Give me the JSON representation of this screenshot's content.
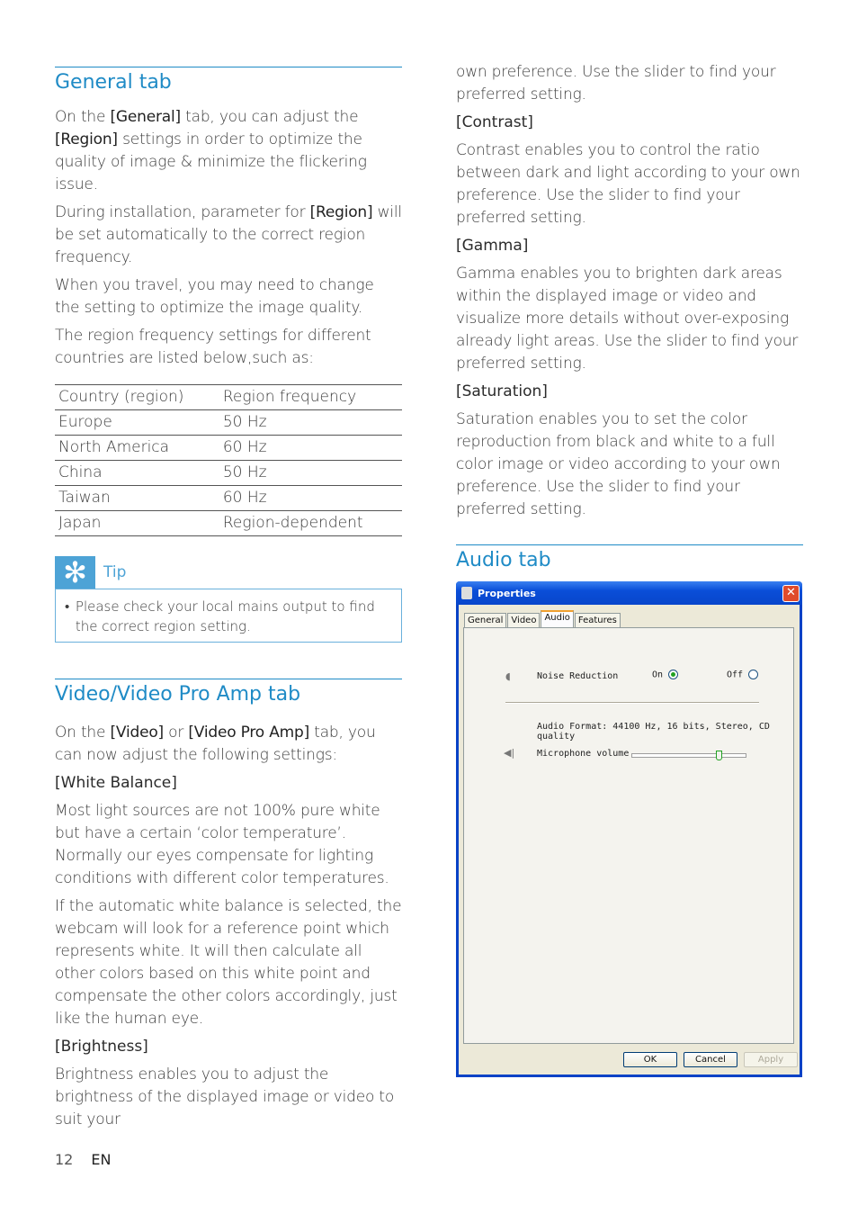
{
  "left": {
    "general": {
      "heading": "General tab",
      "paras": [
        [
          "On the ",
          "[General]",
          " tab, you can adjust the ",
          "[Region]",
          " settings in order to optimize the quality of image & minimize the flickering issue."
        ],
        [
          "During installation, parameter for ",
          "[Region]",
          " will be set automatically to the correct region frequency."
        ]
      ],
      "para3": "When you travel, you may need to change the setting to optimize the image quality.",
      "para4": "The region frequency settings for different countries are listed below,such as:",
      "table": {
        "headers": [
          "Country (region)",
          "Region frequency"
        ],
        "rows": [
          [
            "Europe",
            "50 Hz"
          ],
          [
            "North America",
            "60 Hz"
          ],
          [
            "China",
            "50 Hz"
          ],
          [
            "Taiwan",
            "60 Hz"
          ],
          [
            "Japan",
            "Region-dependent"
          ]
        ]
      }
    },
    "tip": {
      "icon": "tip-asterisk-icon",
      "label": "Tip",
      "bullet": "•",
      "text": "Please check your local mains output to find the correct region setting."
    },
    "video": {
      "heading": "Video/Video Pro Amp tab",
      "intro": [
        "On the ",
        "[Video]",
        " or ",
        "[Video Pro Amp]",
        " tab, you can now adjust the following settings:"
      ],
      "wb_title": "[White Balance]",
      "wb_p1": "Most light sources are not 100% pure white but have a certain ‘color temperature’. Normally our eyes compensate for lighting conditions with different color temperatures.",
      "wb_p2": "If the automatic white balance is selected, the webcam will look for a reference point which represents white. It will then calculate all other colors based on this white point and compensate the other colors accordingly, just like the human eye.",
      "brightness_title": "[Brightness]",
      "brightness_p": "Brightness enables you to adjust the brightness of the displayed image or video to suit your"
    }
  },
  "right": {
    "cont": "own preference. Use the slider to find your preferred setting.",
    "contrast_title": "[Contrast]",
    "contrast_p": "Contrast enables you to control the ratio between dark and light according to your own preference. Use the slider to find your preferred setting.",
    "gamma_title": "[Gamma]",
    "gamma_p": "Gamma enables you to brighten dark areas within the displayed image or video and visualize more details without over-exposing already light areas. Use the slider to find your preferred setting.",
    "saturation_title": "[Saturation]",
    "saturation_p": "Saturation enables you to set the color reproduction from black and white to a full color image or video according to your own preference. Use the slider to find your preferred setting.",
    "audio_heading": "Audio tab"
  },
  "dialog": {
    "title": "Properties",
    "close": "✕",
    "tabs": [
      "General",
      "Video",
      "Audio",
      "Features"
    ],
    "active_tab": "Audio",
    "noise_label": "Noise Reduction",
    "on_label": "On",
    "off_label": "Off",
    "noise_value": "On",
    "format_text": "Audio Format: 44100 Hz, 16 bits, Stereo, CD quality",
    "mic_label": "Microphone volume",
    "mic_volume_fraction": 0.78,
    "buttons": {
      "ok": "OK",
      "cancel": "Cancel",
      "apply": "Apply"
    }
  },
  "footer": {
    "page": "12",
    "lang": "EN"
  }
}
